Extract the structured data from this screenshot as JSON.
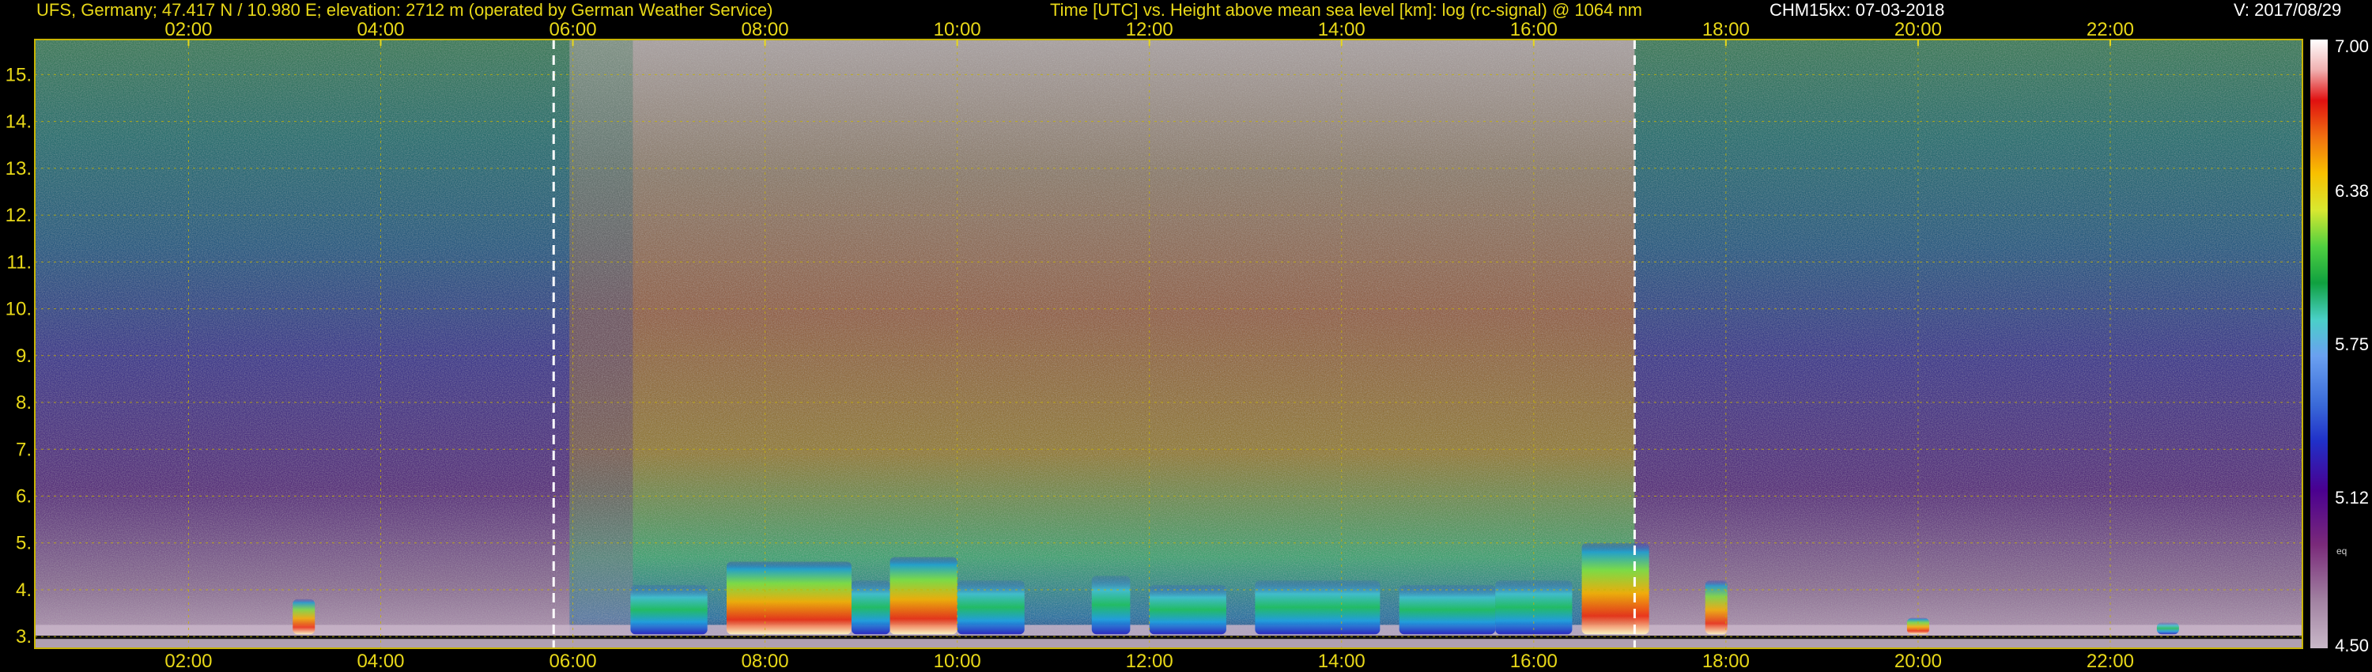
{
  "header": {
    "station": "UFS, Germany; 47.417 N / 10.980 E; elevation: 2712 m  (operated by German Weather Service)",
    "title": "Time [UTC] vs. Height above mean sea level [km]: log (rc-signal) @ 1064 nm",
    "instrument": "CHM15kx: 07-03-2018",
    "version": "V: 2017/08/29"
  },
  "colors": {
    "background": "#000000",
    "header_text": "#e8d818",
    "grid": "#c8b400",
    "sun_marker": "#ffffff"
  },
  "chart_data": {
    "type": "heatmap",
    "title": "Time [UTC] vs. Height above mean sea level [km]: log (rc-signal) @ 1064 nm",
    "xlabel": "Time [UTC]",
    "ylabel": "Height above mean sea level [km]",
    "xlim": [
      0.4,
      24.0
    ],
    "ylim": [
      2.75,
      15.75
    ],
    "x_ticks": [
      "02:00",
      "04:00",
      "06:00",
      "08:00",
      "10:00",
      "12:00",
      "14:00",
      "16:00",
      "18:00",
      "20:00",
      "22:00"
    ],
    "x_tick_values": [
      2,
      4,
      6,
      8,
      10,
      12,
      14,
      16,
      18,
      20,
      22
    ],
    "y_ticks": [
      "3.",
      "4.",
      "5.",
      "6.",
      "7.",
      "8.",
      "9.",
      "10.",
      "11.",
      "12.",
      "13.",
      "14.",
      "15."
    ],
    "y_tick_values": [
      3,
      4,
      5,
      6,
      7,
      8,
      9,
      10,
      11,
      12,
      13,
      14,
      15
    ],
    "grid": true,
    "sunrise_line": 5.8,
    "sunset_line": 17.05,
    "colorbar": {
      "ticks": [
        "7.00",
        "6.38",
        "5.75",
        "5.12",
        "4.50"
      ],
      "tick_values": [
        7.0,
        6.38,
        5.75,
        5.12,
        4.5
      ],
      "range": [
        4.5,
        7.0
      ],
      "label": "eq"
    },
    "aerosol_layer_blocks": [
      {
        "x": [
          6.6,
          7.4
        ],
        "top": 4.1,
        "peak": 5.2
      },
      {
        "x": [
          7.6,
          8.9
        ],
        "top": 4.6,
        "peak": 6.7
      },
      {
        "x": [
          8.9,
          9.3
        ],
        "top": 4.2,
        "peak": 5.4
      },
      {
        "x": [
          9.3,
          10.0
        ],
        "top": 4.7,
        "peak": 6.9
      },
      {
        "x": [
          10.0,
          10.7
        ],
        "top": 4.2,
        "peak": 5.8
      },
      {
        "x": [
          11.4,
          11.8
        ],
        "top": 4.3,
        "peak": 5.8
      },
      {
        "x": [
          12.0,
          12.8
        ],
        "top": 4.1,
        "peak": 5.6
      },
      {
        "x": [
          13.1,
          14.4
        ],
        "top": 4.2,
        "peak": 5.7
      },
      {
        "x": [
          14.6,
          15.6
        ],
        "top": 4.1,
        "peak": 5.5
      },
      {
        "x": [
          15.6,
          16.4
        ],
        "top": 4.2,
        "peak": 5.4
      },
      {
        "x": [
          16.5,
          17.2
        ],
        "top": 5.0,
        "peak": 6.4
      }
    ],
    "night_surface_spots": [
      {
        "x": 3.2,
        "top": 3.8,
        "peak": 6.0
      },
      {
        "x": 17.9,
        "top": 4.2,
        "peak": 6.2
      },
      {
        "x": 20.0,
        "top": 3.4,
        "peak": 6.0
      },
      {
        "x": 22.6,
        "top": 3.3,
        "peak": 5.6
      }
    ]
  }
}
